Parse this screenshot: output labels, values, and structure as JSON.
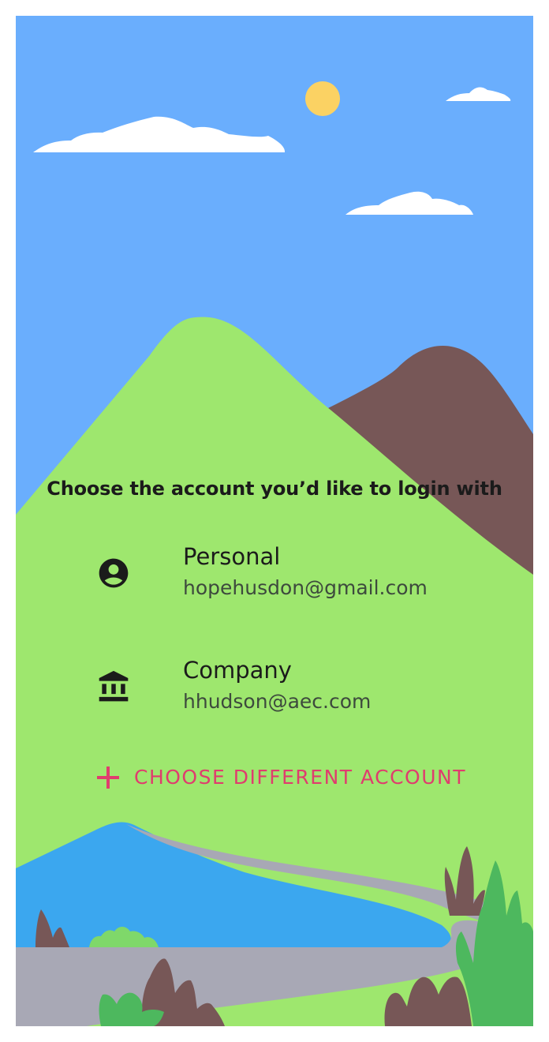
{
  "colors": {
    "sky": "#6aaefd",
    "sun": "#fbd263",
    "mountain_green": "#9ee76e",
    "mountain_brown": "#775757",
    "lake": "#3ba7ef",
    "road": "#a8a8b5",
    "accent": "#e03c6e",
    "text": "#1b1b1b"
  },
  "heading": "Choose the account you’d like to login with",
  "accounts": [
    {
      "name": "Personal",
      "email": "hopehusdon@gmail.com",
      "icon": "account-circle-icon"
    },
    {
      "name": "Company",
      "email": "hhudson@aec.com",
      "icon": "bank-icon"
    }
  ],
  "choose_different": {
    "label": "CHOOSE DIFFERENT ACCOUNT",
    "icon": "plus-icon"
  }
}
